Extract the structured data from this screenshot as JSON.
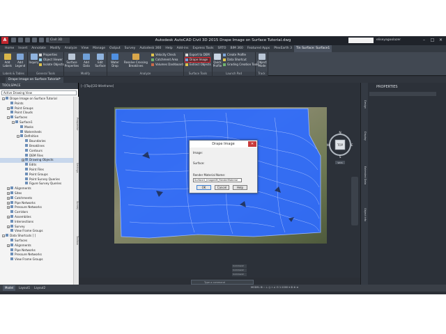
{
  "app": {
    "window_title": "Autodesk AutoCAD Civil 3D 2015    Drape Image on Surface Tutorial.dwg",
    "doc_dropdown": "Civil 3D",
    "search_placeholder": "",
    "user": "eliseyagoolazer",
    "window_controls": [
      "–",
      "□",
      "✕"
    ]
  },
  "ribbon": {
    "tabs": [
      "Home",
      "Insert",
      "Annotate",
      "Modify",
      "Analyze",
      "View",
      "Manage",
      "Output",
      "Survey",
      "Autodesk 360",
      "Help",
      "Add-ins",
      "Express Tools",
      "SRTO",
      "BIM 360",
      "Featured Apps",
      "PlexEarth 3",
      "Tin Surface: Surface1"
    ],
    "active_tab": "Tin Surface: Surface1",
    "panels": [
      {
        "title": "Labels & Tables",
        "buttons": [
          "Add Labels",
          "Add Legend"
        ]
      },
      {
        "title": "General Tools",
        "buttons": [
          "Inquiry",
          "Properties",
          "Object Viewer",
          "Isolate Objects"
        ]
      },
      {
        "title": "Modify",
        "buttons": [
          "Add Data",
          "Edit Surface",
          "Surface Properties"
        ]
      },
      {
        "title": "Analyze",
        "buttons": [
          "Water Drop",
          "Resolve Crossing Breaklines",
          "Volumes Dashboard",
          "Catchment Area",
          "Velocity Check"
        ]
      },
      {
        "title": "Surface Tools",
        "buttons": [
          "Export to DEM",
          "Drape Image",
          "Extract Objects"
        ]
      },
      {
        "title": "Launch Pad",
        "buttons": [
          "Quick Profile",
          "Create Profile",
          "Data Shortcut",
          "Grading Creation Tools"
        ]
      },
      {
        "title": "Track",
        "buttons": [
          "Object Mode"
        ]
      }
    ]
  },
  "file_tab": "Drape Image on Surface Tutorial*",
  "toolspace": {
    "title": "TOOLSPACE",
    "view": "Active Drawing View",
    "tree": [
      {
        "label": "Drape Image on Surface Tutorial",
        "level": 0,
        "toggle": "−"
      },
      {
        "label": "Points",
        "level": 1,
        "toggle": ""
      },
      {
        "label": "Point Groups",
        "level": 1,
        "toggle": "+"
      },
      {
        "label": "Point Clouds",
        "level": 1,
        "toggle": ""
      },
      {
        "label": "Surfaces",
        "level": 1,
        "toggle": "−"
      },
      {
        "label": "Surface1",
        "level": 2,
        "toggle": "−"
      },
      {
        "label": "Masks",
        "level": 3,
        "toggle": ""
      },
      {
        "label": "Watersheds",
        "level": 3,
        "toggle": ""
      },
      {
        "label": "Definition",
        "level": 3,
        "toggle": "−"
      },
      {
        "label": "Boundaries",
        "level": 4,
        "toggle": ""
      },
      {
        "label": "Breaklines",
        "level": 4,
        "toggle": ""
      },
      {
        "label": "Contours",
        "level": 4,
        "toggle": ""
      },
      {
        "label": "DEM Files",
        "level": 4,
        "toggle": ""
      },
      {
        "label": "Drawing Objects",
        "level": 4,
        "toggle": "+",
        "selected": true
      },
      {
        "label": "Edits",
        "level": 4,
        "toggle": ""
      },
      {
        "label": "Point Files",
        "level": 4,
        "toggle": ""
      },
      {
        "label": "Point Groups",
        "level": 4,
        "toggle": ""
      },
      {
        "label": "Point Survey Queries",
        "level": 4,
        "toggle": ""
      },
      {
        "label": "Figure Survey Queries",
        "level": 4,
        "toggle": ""
      },
      {
        "label": "Alignments",
        "level": 1,
        "toggle": "+"
      },
      {
        "label": "Sites",
        "level": 1,
        "toggle": "+"
      },
      {
        "label": "Catchments",
        "level": 1,
        "toggle": "+"
      },
      {
        "label": "Pipe Networks",
        "level": 1,
        "toggle": "+"
      },
      {
        "label": "Pressure Networks",
        "level": 1,
        "toggle": "+"
      },
      {
        "label": "Corridors",
        "level": 1,
        "toggle": ""
      },
      {
        "label": "Assemblies",
        "level": 1,
        "toggle": "+"
      },
      {
        "label": "Intersections",
        "level": 1,
        "toggle": ""
      },
      {
        "label": "Survey",
        "level": 1,
        "toggle": "+"
      },
      {
        "label": "View Frame Groups",
        "level": 1,
        "toggle": ""
      },
      {
        "label": "Data Shortcuts [ ]",
        "level": 0,
        "toggle": "−"
      },
      {
        "label": "Surfaces",
        "level": 1,
        "toggle": ""
      },
      {
        "label": "Alignments",
        "level": 1,
        "toggle": "+"
      },
      {
        "label": "Pipe Networks",
        "level": 1,
        "toggle": ""
      },
      {
        "label": "Pressure Networks",
        "level": 1,
        "toggle": ""
      },
      {
        "label": "View Frame Groups",
        "level": 1,
        "toggle": ""
      }
    ],
    "side_tabs": [
      "Prospector",
      "Settings",
      "Survey",
      "Toolbox"
    ]
  },
  "viewport": {
    "label": "[−][Top][2D Wireframe]",
    "viewcube": {
      "n": "N",
      "s": "S",
      "e": "E",
      "w": "W",
      "face": "TOP",
      "wcs": "WCS"
    }
  },
  "dialog": {
    "title": "Drape Image",
    "image_label": "Image:",
    "surface_label": "Surface:",
    "render_label": "Render Material Name:",
    "render_value": "Surface1_ImageAM_RenderMaterial",
    "buttons": [
      "OK",
      "Cancel",
      "Help"
    ]
  },
  "properties": {
    "title": "PROPERTIES",
    "strip_tabs": [
      "Design",
      "Display",
      "Extended Data",
      "Object Info"
    ]
  },
  "command": {
    "history": [
      "Command:",
      "Command:",
      "Command:"
    ],
    "prompt": "Type a command"
  },
  "status": {
    "tabs": [
      "Model",
      "Layout1",
      "Layout2"
    ],
    "active": "Model",
    "right": "MODEL   ⊞  ∷  ⊥  ◎  ⌖  ∠  ⊡  1:1000 ▾   ⚙   ⊕  ≡",
    "coords": "5'-1/1032LE"
  },
  "colors": {
    "accent_red": "#e0262f",
    "surface_blue": "#2f6bff",
    "ribbon_bg": "#414852"
  }
}
